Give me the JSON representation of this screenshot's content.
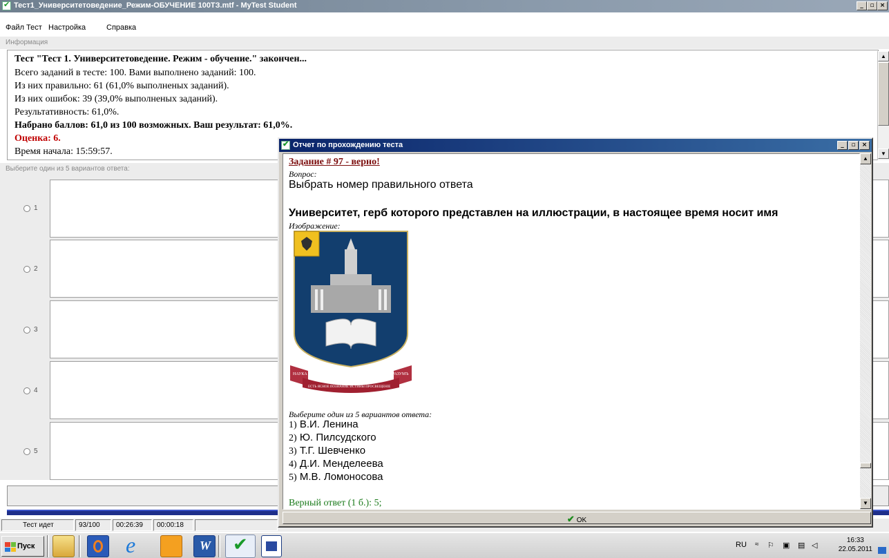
{
  "window": {
    "title": "Тест1_Университетоведение_Режим-ОБУЧЕНИЕ 100ТЗ.mtf - MyTest Student",
    "min_glyph": "_",
    "max_glyph": "▫",
    "close_glyph": "×"
  },
  "menu": {
    "items": [
      "Файл",
      "Тест",
      "Настройка",
      "Справка"
    ]
  },
  "info_section": {
    "label": "Информация",
    "lines": [
      "Тест \"Тест 1. Университетоведение. Режим - обучение.\" закончен...",
      "Всего заданий в тесте: 100. Вами выполнено заданий: 100.",
      "Из них правильно: 61 (61,0% выполненых заданий).",
      "Из них ошибок: 39 (39,0% выполненых заданий).",
      "Результативность: 61,0%.",
      "Набрано баллов: 61,0 из 100 возможных. Ваш результат: 61,0%.",
      "Оценка: 6.",
      "Время начала: 15:59:57."
    ]
  },
  "answers_section": {
    "label": "Выберите один из 5 вариантов ответа:",
    "options": [
      "1",
      "2",
      "3",
      "4",
      "5"
    ]
  },
  "status": {
    "state": "Тест идет",
    "progress": "93/100",
    "elapsed": "00:26:39",
    "question_time": "00:00:18"
  },
  "taskbar": {
    "start_label": "Пуск",
    "lang": "RU",
    "time": "16:33",
    "date": "22.05.2011"
  },
  "dialog": {
    "title": "Отчет по прохождению теста",
    "task_header": "Задание # 97 - верно!",
    "question_label": "Вопрос:",
    "question_type": "Выбрать номер правильного ответа",
    "question_text": "Университет, герб которого представлен на иллюстрации, в настоящее время носит имя",
    "image_label": "Изображение:",
    "emblem_ribbon_left": "НАУКА",
    "emblem_ribbon_right": "РАЗУМЪ",
    "emblem_ribbon_bottom": "ЕСТЬ ЯСНОЕ ПОЗНАНИЕ ИСТИНЫ ПРОСВЕЩЕНIЕ",
    "options_label": "Выберите один из 5 вариантов ответа:",
    "options": [
      {
        "num": "1)",
        "text": "В.И. Ленина"
      },
      {
        "num": "2)",
        "text": "Ю. Пилсудского"
      },
      {
        "num": "3)",
        "text": "Т.Г. Шевченко"
      },
      {
        "num": "4)",
        "text": "Д.И. Менделеева"
      },
      {
        "num": "5)",
        "text": "М.В. Ломоносова"
      }
    ],
    "correct_answer": "Верный ответ (1 б.): 5;",
    "ok_label": "OK"
  }
}
